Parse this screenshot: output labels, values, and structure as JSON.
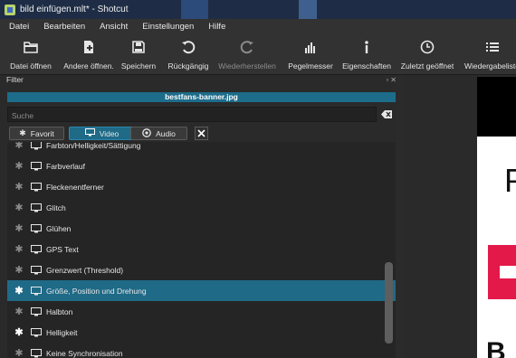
{
  "window": {
    "title": "bild einfügen.mlt* - Shotcut"
  },
  "menu": [
    {
      "label": "Datei"
    },
    {
      "label": "Bearbeiten"
    },
    {
      "label": "Ansicht"
    },
    {
      "label": "Einstellungen"
    },
    {
      "label": "Hilfe"
    }
  ],
  "toolbar": {
    "open": "Datei öffnen",
    "open_other": "Andere öffnen.",
    "save": "Speichern",
    "undo": "Rückgängig",
    "redo": "Wiederherstellen",
    "meter": "Pegelmesser",
    "properties": "Eigenschaften",
    "recent": "Zuletzt geöffnet",
    "playlist": "Wiedergabeliste"
  },
  "filter_panel": {
    "title": "Filter",
    "clip_name": "bestfans-banner.jpg",
    "search_placeholder": "Suche",
    "tabs": {
      "favorite": "Favorit",
      "video": "Video",
      "audio": "Audio"
    },
    "items": [
      {
        "label": "Farbton/Helligkeit/Sättigung",
        "favorite": false,
        "selected": false
      },
      {
        "label": "Farbverlauf",
        "favorite": false,
        "selected": false
      },
      {
        "label": "Fleckenentferner",
        "favorite": false,
        "selected": false
      },
      {
        "label": "Glitch",
        "favorite": false,
        "selected": false
      },
      {
        "label": "Glühen",
        "favorite": false,
        "selected": false
      },
      {
        "label": "GPS Text",
        "favorite": false,
        "selected": false
      },
      {
        "label": "Grenzwert (Threshold)",
        "favorite": false,
        "selected": false
      },
      {
        "label": "Größe, Position und Drehung",
        "favorite": true,
        "selected": true
      },
      {
        "label": "Halbton",
        "favorite": false,
        "selected": false
      },
      {
        "label": "Helligkeit",
        "favorite": true,
        "selected": false
      },
      {
        "label": "Keine Synchronisation",
        "favorite": false,
        "selected": false
      }
    ]
  },
  "colors": {
    "accent": "#1f6a87",
    "titlebar": "#1e2d45",
    "preview_pink": "#e3194a"
  }
}
